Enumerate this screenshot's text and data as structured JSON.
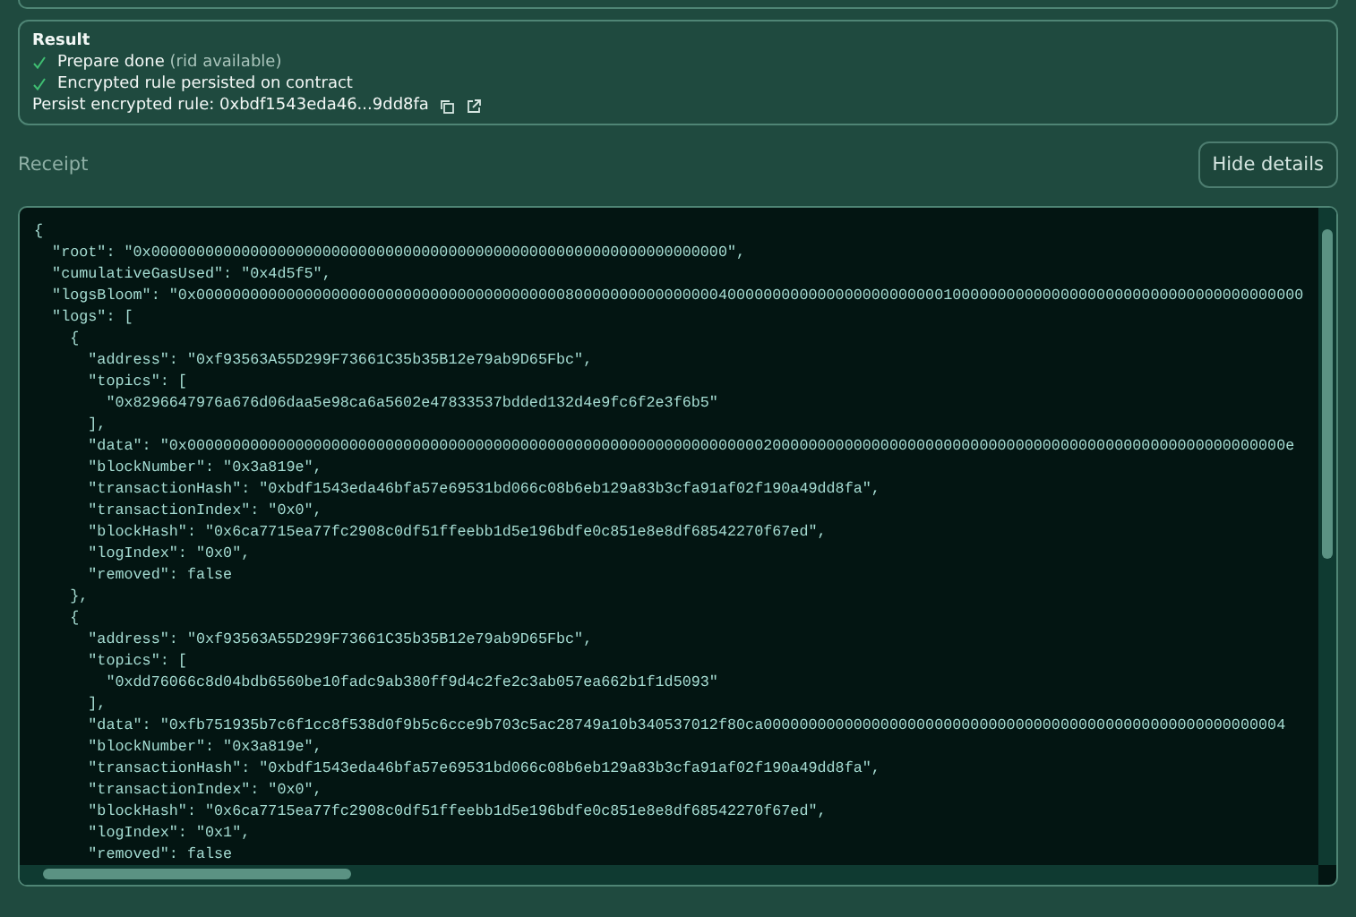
{
  "result": {
    "title": "Result",
    "steps": [
      {
        "text": "Prepare done",
        "note": "(rid available)",
        "done": true
      },
      {
        "text": "Encrypted rule persisted on contract",
        "done": true
      }
    ],
    "persist": {
      "label": "Persist encrypted rule:",
      "value": "0xbdf1543eda46...9dd8fa"
    }
  },
  "receipt": {
    "label": "Receipt",
    "toggle": "Hide details",
    "lines": [
      "{",
      "  \"root\": \"0x0000000000000000000000000000000000000000000000000000000000000000\",",
      "  \"cumulativeGasUsed\": \"0x4d5f5\",",
      "  \"logsBloom\": \"0x000000000000000000000000000000000000000008000000000000000040000000000000000000000001000000000000000000000000000000000000000",
      "  \"logs\": [",
      "    {",
      "      \"address\": \"0xf93563A55D299F73661C35b35B12e79ab9D65Fbc\",",
      "      \"topics\": [",
      "        \"0x8296647976a676d06daa5e98ca6a5602e47833537bdded132d4e9fc6f2e3f6b5\"",
      "      ],",
      "      \"data\": \"0x00000000000000000000000000000000000000000000000000000000000000002000000000000000000000000000000000000000000000000000000000e",
      "      \"blockNumber\": \"0x3a819e\",",
      "      \"transactionHash\": \"0xbdf1543eda46bfa57e69531bd066c08b6eb129a83b3cfa91af02f190a49dd8fa\",",
      "      \"transactionIndex\": \"0x0\",",
      "      \"blockHash\": \"0x6ca7715ea77fc2908c0df51ffeebb1d5e196bdfe0c851e8e8df68542270f67ed\",",
      "      \"logIndex\": \"0x0\",",
      "      \"removed\": false",
      "    },",
      "    {",
      "      \"address\": \"0xf93563A55D299F73661C35b35B12e79ab9D65Fbc\",",
      "      \"topics\": [",
      "        \"0xdd76066c8d04bdb6560be10fadc9ab380ff9d4c2fe2c3ab057ea662b1f1d5093\"",
      "      ],",
      "      \"data\": \"0xfb751935b7c6f1cc8f538d0f9b5c6cce9b703c5ac28749a10b340537012f80ca0000000000000000000000000000000000000000000000000000000004",
      "      \"blockNumber\": \"0x3a819e\",",
      "      \"transactionHash\": \"0xbdf1543eda46bfa57e69531bd066c08b6eb129a83b3cfa91af02f190a49dd8fa\",",
      "      \"transactionIndex\": \"0x0\",",
      "      \"blockHash\": \"0x6ca7715ea77fc2908c0df51ffeebb1d5e196bdfe0c851e8e8df68542270f67ed\",",
      "      \"logIndex\": \"0x1\",",
      "      \"removed\": false"
    ]
  }
}
